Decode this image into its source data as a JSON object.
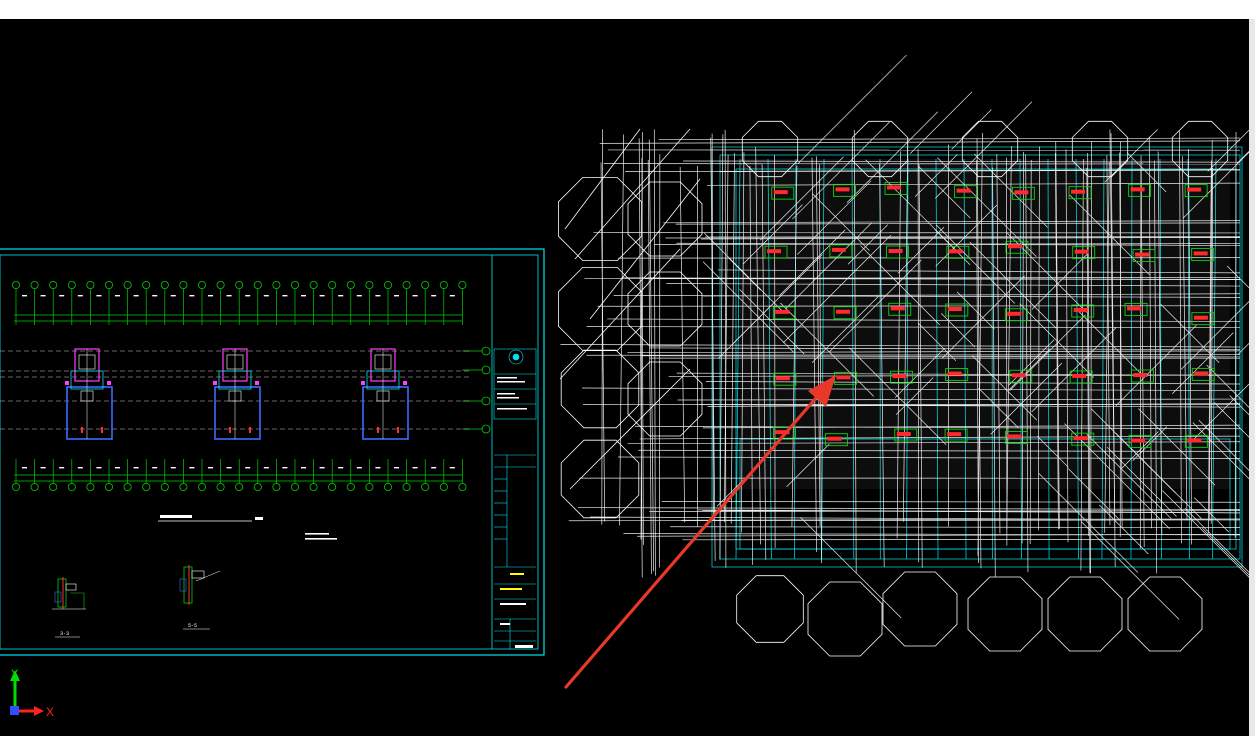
{
  "app": {
    "view": "Model space"
  },
  "ucs": {
    "x_label": "X",
    "y_label": "Y"
  },
  "colors": {
    "background": "#000000",
    "frame": "#00e5ee",
    "grid": "#00d000",
    "core": "#ff40ff",
    "walls": "#3b6bff",
    "wireframe": "#ffffff",
    "tags": "#ff2020",
    "arrow": "#e8382a"
  },
  "drawing_sheet": {
    "section_labels": [
      "3-3",
      "5-5"
    ]
  },
  "annotation": {
    "arrow_icon": "red-pointer-arrow"
  }
}
